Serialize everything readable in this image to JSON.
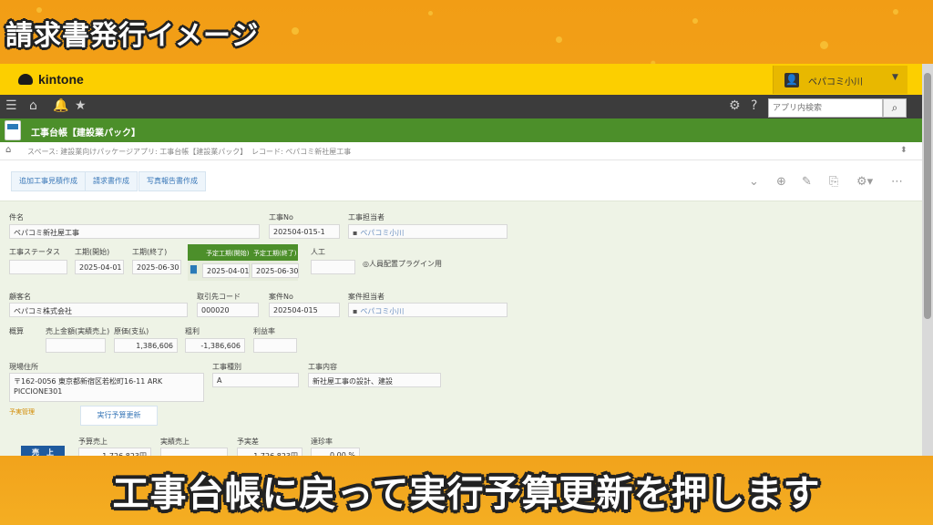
{
  "overlay": {
    "title": "請求書発行イメージ",
    "caption": "工事台帳に戻って実行予算更新を押します"
  },
  "header": {
    "logo": "kintone",
    "user_name": "ペパコミ小川",
    "search_placeholder": "アプリ内検索"
  },
  "app": {
    "name": "工事台帳【建設業パック】"
  },
  "breadcrumb": {
    "space": "スペース: 建設業向けパッケージ",
    "app": "アプリ: 工事台帳【建設業パック】",
    "record": "レコード: ペパコミ新社屋工事"
  },
  "actions": {
    "btn1": "追加工事見積作成",
    "btn2": "請求書作成",
    "btn3": "写真報告書作成"
  },
  "form": {
    "subject_label": "件名",
    "subject_value": "ペパコミ新社屋工事",
    "work_no_label": "工事No",
    "work_no_value": "202504-015-1",
    "manager_label": "工事担当者",
    "manager_value": "ペパコミ小川",
    "status_label": "工事ステータス",
    "start_label": "工期(開始)",
    "start_value": "2025-04-01",
    "end_label": "工期(終了)",
    "end_value": "2025-06-30",
    "plan_start_label": "予定工期(開始)",
    "plan_start_value": "2025-04-01",
    "plan_end_label": "予定工期(終了)",
    "plan_end_value": "2025-06-30",
    "worker_label": "人工",
    "plugin_note": "◎人員配置プラグイン用",
    "customer_label": "顧客名",
    "customer_value": "ペパコミ株式会社",
    "client_code_label": "取引先コード",
    "client_code_value": "000020",
    "case_no_label": "案件No",
    "case_no_value": "202504-015",
    "case_manager_label": "案件担当者",
    "case_manager_value": "ペパコミ小川",
    "summary_label": "概算",
    "sales_label": "売上金額(実績売上)",
    "cost_label": "原価(支払)",
    "cost_value": "1,386,606",
    "gross_label": "粗利",
    "gross_value": "-1,386,606",
    "margin_label": "利益率",
    "site_label": "現場住所",
    "site_value_1": "〒162-0056 東京都新宿区若松町16-11 ARK",
    "site_value_2": "PICCIONE301",
    "type_label": "工事種別",
    "type_value": "A",
    "content_label": "工事内容",
    "content_value": "新社屋工事の設計、建設",
    "budget_section": "予実管理",
    "budget_button": "実行予算更新",
    "sales_chip": "売　上",
    "budget_sales_label": "予算売上",
    "actual_sales_label": "実績売上",
    "diff_label": "予実差",
    "rate_label": "達珍率",
    "budget_sales_value": "1,726,823円",
    "diff_value": "1,726,823円",
    "rate_value": "0.00 %"
  }
}
